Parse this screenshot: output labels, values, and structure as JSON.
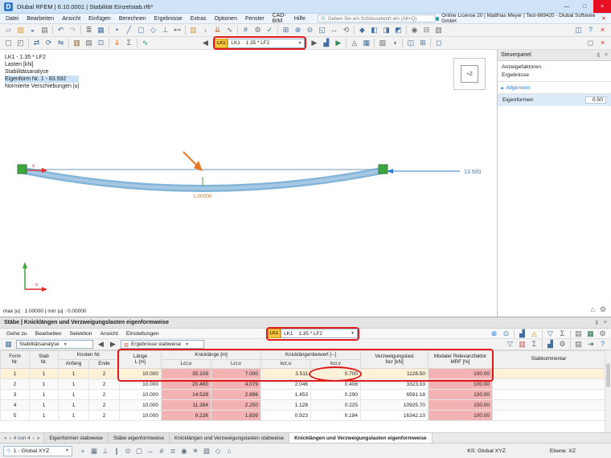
{
  "window": {
    "title": "Dlubal RFEM | 6.10.0001 | Stabilität Einzelstab.rf6*",
    "controls": {
      "minimize": "—",
      "maximize": "□",
      "close": "×"
    }
  },
  "menubar": {
    "items": [
      "Datei",
      "Bearbeiten",
      "Ansicht",
      "Einfügen",
      "Berechnen",
      "Ergebnisse",
      "Extras",
      "Optionen",
      "Fenster",
      "CAD-BIM",
      "Hilfe"
    ],
    "search_placeholder": "Geben Sie ein Schlüsselwort ein (Alt+Q)",
    "license": "Online License 20 | Matthias Meyer | Test-669420 - Dlubal Software GmbH"
  },
  "load_combo": {
    "badge": "LK1",
    "name": "LK1",
    "value": "1.35 * LF2"
  },
  "toolbar1": [
    {
      "n": "new-model-icon",
      "g": "▱",
      "c": "#6b86a8"
    },
    {
      "n": "open-model-icon",
      "g": "▨",
      "c": "#d09a3c"
    },
    {
      "n": "save-icon",
      "g": "◒",
      "c": "#46719e"
    },
    {
      "n": "print-icon",
      "g": "▤",
      "c": "#6a6a6a"
    },
    {
      "sep": true
    },
    {
      "n": "undo-icon",
      "g": "↶",
      "c": "#46719e"
    },
    {
      "n": "redo-icon",
      "g": "↷",
      "c": "#9fb2c6"
    },
    {
      "sep": true
    },
    {
      "n": "navigator-icon",
      "g": "≣",
      "c": "#6a6a6a"
    },
    {
      "n": "tables-icon",
      "g": "▦",
      "c": "#46719e"
    },
    {
      "sep": true
    },
    {
      "n": "node-icon",
      "g": "•",
      "c": "#46719e"
    },
    {
      "n": "member-icon",
      "g": "╱",
      "c": "#46719e"
    },
    {
      "n": "surface-icon",
      "g": "▢",
      "c": "#46719e"
    },
    {
      "n": "solid-icon",
      "g": "◇",
      "c": "#46719e"
    },
    {
      "n": "support-icon",
      "g": "⊥",
      "c": "#2e8b57"
    },
    {
      "n": "hinge-icon",
      "g": "⊷",
      "c": "#6a6a6a"
    },
    {
      "sep": true
    },
    {
      "n": "load-case-icon",
      "g": "▥",
      "c": "#d09a3c"
    },
    {
      "n": "nodal-load-icon",
      "g": "↓",
      "c": "#d2691e"
    },
    {
      "n": "member-load-icon",
      "g": "⇊",
      "c": "#d2691e"
    },
    {
      "n": "imperfection-icon",
      "g": "∿",
      "c": "#6a6a6a"
    },
    {
      "sep": true
    },
    {
      "n": "mesh-icon",
      "g": "#",
      "c": "#46719e"
    },
    {
      "n": "calculate-icon",
      "g": "⚙",
      "c": "#6a6a6a"
    },
    {
      "n": "check-results-icon",
      "g": "✓",
      "c": "#2e8b57"
    },
    {
      "sep": true
    },
    {
      "n": "zoom-window-icon",
      "g": "⊞",
      "c": "#46719e"
    },
    {
      "n": "zoom-in-icon",
      "g": "⊕",
      "c": "#46719e"
    },
    {
      "n": "zoom-out-icon",
      "g": "⊖",
      "c": "#46719e"
    },
    {
      "n": "zoom-all-icon",
      "g": "◱",
      "c": "#46719e"
    },
    {
      "n": "pan-icon",
      "g": "↔",
      "c": "#6a6a6a"
    },
    {
      "n": "orbit-icon",
      "g": "⟲",
      "c": "#6a6a6a"
    },
    {
      "sep": true
    },
    {
      "n": "view-isometric-icon",
      "g": "◆",
      "c": "#46719e"
    },
    {
      "n": "view-x-icon",
      "g": "◧",
      "c": "#46719e"
    },
    {
      "n": "view-y-icon",
      "g": "◨",
      "c": "#46719e"
    },
    {
      "n": "view-z-icon",
      "g": "◩",
      "c": "#46719e"
    },
    {
      "sep": true
    },
    {
      "n": "visibility-icon",
      "g": "◉",
      "c": "#6a6a6a"
    },
    {
      "n": "section-view-icon",
      "g": "⊟",
      "c": "#6a6a6a"
    },
    {
      "n": "display-properties-icon",
      "g": "▧",
      "c": "#6a6a6a"
    },
    {
      "flex": true
    },
    {
      "n": "windows-icon",
      "g": "◫",
      "c": "#46719e"
    },
    {
      "n": "help-icon",
      "g": "?",
      "c": "#2d7dd2"
    },
    {
      "n": "close-view-icon",
      "g": "×",
      "c": "#d22222"
    }
  ],
  "toolbar2_left": [
    {
      "n": "edit-select-icon",
      "g": "▢",
      "c": "#6a6a6a"
    },
    {
      "n": "select-all-icon",
      "g": "◰",
      "c": "#6a6a6a"
    },
    {
      "sep": true
    },
    {
      "n": "move-icon",
      "g": "⇄",
      "c": "#46719e"
    },
    {
      "n": "rotate-icon",
      "g": "⟳",
      "c": "#46719e"
    },
    {
      "n": "mirror-icon",
      "g": "⇋",
      "c": "#46719e"
    },
    {
      "sep": true
    },
    {
      "n": "section-library-icon",
      "g": "▥",
      "c": "#8a5a2a"
    },
    {
      "n": "material-icon",
      "g": "▤",
      "c": "#6a6a6a"
    },
    {
      "n": "nodes-table-icon",
      "g": "⊡",
      "c": "#46719e"
    },
    {
      "sep": true
    },
    {
      "n": "member-loads-icon",
      "g": "⇓",
      "c": "#d2691e"
    },
    {
      "n": "load-generation-icon",
      "g": "Σ",
      "c": "#6a6a6a"
    },
    {
      "sep": true
    },
    {
      "n": "show-results-icon",
      "g": "∿",
      "c": "#2e8b57"
    }
  ],
  "toolbar2_right": [
    {
      "n": "results-diagram-icon",
      "g": "▟",
      "c": "#46719e"
    },
    {
      "n": "animate-mode-icon",
      "g": "▶",
      "c": "#2e8b57"
    },
    {
      "sep": true
    },
    {
      "n": "result-values-icon",
      "g": "◬",
      "c": "#6a6a6a"
    },
    {
      "n": "result-table-icon",
      "g": "▦",
      "c": "#46719e"
    },
    {
      "sep": true
    },
    {
      "n": "render-icon",
      "g": "▧",
      "c": "#6a6a6a"
    },
    {
      "n": "shadow-icon",
      "g": "◑",
      "c": "#6a6a6a"
    },
    {
      "sep": true
    },
    {
      "n": "new-window-icon",
      "g": "◫",
      "c": "#46719e"
    },
    {
      "n": "split-window-icon",
      "g": "⊞",
      "c": "#46719e"
    },
    {
      "sep": true
    },
    {
      "n": "dock-panels-icon",
      "g": "◻",
      "c": "#46719e"
    },
    {
      "flex": true
    },
    {
      "n": "fullscreen-icon",
      "g": "◻",
      "c": "#6a6a6a"
    },
    {
      "n": "close-panel-icon",
      "g": "×",
      "c": "#d22222"
    }
  ],
  "viewport": {
    "info_lines": [
      "LK1 - 1.35 * LF2",
      "Lasten [kN]",
      "Stabilitätsanalyse",
      "Eigenform Nr. 1 - 83.592",
      "Normierte Verschiebungen |u|"
    ],
    "dimension_label": "13.500",
    "deflection_label": "1.00000",
    "axis_x_label": "x",
    "nav_cube_label": "+Z",
    "minmax_line": "max |u| : 1.00000 | min |u| : 0.00000"
  },
  "steuerpanel": {
    "title": "Steuerpanel",
    "links": [
      "Anzeigefaktoren",
      "Ergebnisse"
    ],
    "section_label": "Allgemein",
    "rows": [
      {
        "label": "Eigenformen",
        "value": "0.50"
      }
    ]
  },
  "bottom_panel": {
    "title": "Stäbe | Knicklängen und Verzweigungslasten eigenformweise",
    "menus": [
      "Gehe zu",
      "Bearbeiten",
      "Selektion",
      "Ansicht",
      "Einstellungen"
    ],
    "menu_icons": [
      {
        "n": "zoom-to-result-icon",
        "g": "⊕",
        "c": "#2d7dd2"
      },
      {
        "n": "search-icon",
        "g": "⊙",
        "c": "#2d7dd2"
      },
      {
        "sep": true
      },
      {
        "n": "result-chart-icon",
        "g": "▟",
        "c": "#46719e"
      },
      {
        "n": "relevance-icon",
        "g": "◬",
        "c": "#d09a3c"
      },
      {
        "sep": true
      },
      {
        "n": "filter-icon",
        "g": "▽",
        "c": "#46719e"
      },
      {
        "n": "sum-icon",
        "g": "Σ",
        "c": "#6a6a6a"
      },
      {
        "sep": true
      },
      {
        "n": "print-table-icon",
        "g": "▤",
        "c": "#6a6a6a"
      },
      {
        "n": "export-excel-icon",
        "g": "▦",
        "c": "#217346"
      },
      {
        "n": "table-settings-icon",
        "g": "⚙",
        "c": "#6a6a6a"
      }
    ],
    "combo_table": "Stabilitätsanalyse",
    "combo_results": "Ergebnisse stabweise",
    "toolbar_icons": [
      {
        "n": "filter-rows-icon",
        "g": "▽",
        "c": "#46719e"
      },
      {
        "n": "color-scale-icon",
        "g": "▥",
        "c": "#c0504d"
      },
      {
        "n": "sum-rows-icon",
        "g": "Σ",
        "c": "#6a6a6a"
      },
      {
        "sep": true
      },
      {
        "n": "diagram-icon",
        "g": "▟",
        "c": "#46719e"
      },
      {
        "n": "settings-icon",
        "g": "⚙",
        "c": "#6a6a6a"
      },
      {
        "sep": true
      },
      {
        "n": "print-icon",
        "g": "▤",
        "c": "#6a6a6a"
      },
      {
        "n": "export-icon",
        "g": "⇥",
        "c": "#217346"
      },
      {
        "n": "table-help-icon",
        "g": "?",
        "c": "#2d7dd2"
      }
    ],
    "table": {
      "columns": [
        {
          "top": "Form",
          "bot": "Nr."
        },
        {
          "top": "Stab",
          "bot": "Nr."
        },
        {
          "group": "Knoten Nr.",
          "subs": [
            "Anfang",
            "Ende"
          ]
        },
        {
          "top": "Länge",
          "bot": "L [m]"
        },
        {
          "group": "Knicklänge [m]",
          "subs": [
            "Lcr,u",
            "Lcr,v"
          ]
        },
        {
          "group": "Knicklängenbeiwert [--]",
          "subs": [
            "kcr,u",
            "kcr,v"
          ]
        },
        {
          "top": "Verzweigungslast",
          "bot": "Ncr [kN]"
        },
        {
          "top": "Modaler Relevanzfaktor",
          "bot": "MRF [%]"
        },
        {
          "top": "Stabkommentar",
          "bot": ""
        }
      ],
      "rows": [
        [
          "1",
          "1",
          "1",
          "2",
          "10.000",
          "35.109",
          "7.000",
          "3.511",
          "0.700",
          "1128.50",
          "100.00",
          ""
        ],
        [
          "2",
          "1",
          "1",
          "2",
          "10.000",
          "20.460",
          "4.079",
          "2.046",
          "0.408",
          "3323.03",
          "100.00",
          ""
        ],
        [
          "3",
          "1",
          "1",
          "2",
          "10.000",
          "14.528",
          "2.896",
          "1.453",
          "0.290",
          "6591.18",
          "100.00",
          ""
        ],
        [
          "4",
          "1",
          "1",
          "2",
          "10.000",
          "11.284",
          "2.250",
          "1.128",
          "0.225",
          "10925.70",
          "100.00",
          ""
        ],
        [
          "5",
          "1",
          "1",
          "2",
          "10.000",
          "9.226",
          "1.839",
          "0.923",
          "0.184",
          "16342.10",
          "100.00",
          ""
        ]
      ],
      "pink_columns": [
        5,
        6,
        10
      ],
      "selected_row": 0
    }
  },
  "tabs": {
    "pager": "4 von 4",
    "items": [
      "Eigenformen stabweise",
      "Stäbe eigenformweise",
      "Knicklängen und Verzweigungslasten stabweise",
      "Knicklängen und Verzweigungslasten eigenformweise"
    ],
    "active_index": 3
  },
  "statusbar": {
    "cs_combo": "1 - Global XYZ",
    "icons": [
      {
        "n": "snap-icon",
        "g": "+",
        "c": "#5a6b7a"
      },
      {
        "n": "grid-icon",
        "g": "▦",
        "c": "#5a6b7a"
      },
      {
        "n": "ortho-icon",
        "g": "⊥",
        "c": "#5a6b7a"
      },
      {
        "n": "guidelines-icon",
        "g": "∥",
        "c": "#5a6b7a"
      },
      {
        "n": "object-snap-icon",
        "g": "⊙",
        "c": "#5a6b7a"
      },
      {
        "n": "select-mode-icon",
        "g": "▢",
        "c": "#5a6b7a"
      },
      {
        "n": "measure-icon",
        "g": "↔",
        "c": "#5a6b7a"
      },
      {
        "n": "coordinates-icon",
        "g": "#",
        "c": "#5a6b7a"
      },
      {
        "n": "layers-icon",
        "g": "≣",
        "c": "#5a6b7a"
      },
      {
        "n": "view-mode-icon",
        "g": "◉",
        "c": "#5a6b7a"
      },
      {
        "n": "light-icon",
        "g": "☀",
        "c": "#5a6b7a"
      },
      {
        "n": "render-mode-icon",
        "g": "▧",
        "c": "#5a6b7a"
      },
      {
        "n": "workplane-icon",
        "g": "◇",
        "c": "#5a6b7a"
      },
      {
        "n": "home-cs-icon",
        "g": "⌂",
        "c": "#5a6b7a"
      }
    ],
    "ks_label": "KS: Global XYZ",
    "plane_label": "Ebene: XZ"
  }
}
